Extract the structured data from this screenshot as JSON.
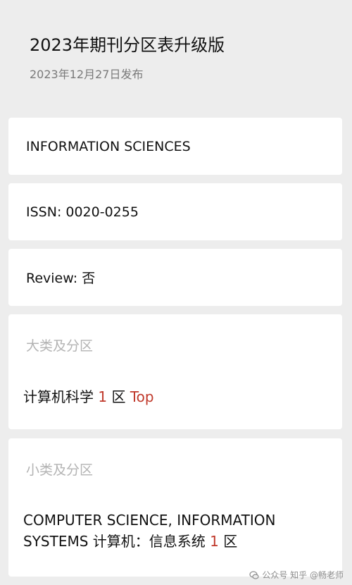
{
  "header": {
    "title": "2023年期刊分区表升级版",
    "date": "2023年12月27日发布"
  },
  "journal": {
    "name": "INFORMATION SCIENCES",
    "issn": "ISSN: 0020-0255",
    "review": "Review: 否"
  },
  "major": {
    "label": "大类及分区",
    "category": "计算机科学",
    "zone": "1",
    "zone_suffix": "区",
    "top": "Top"
  },
  "minor": {
    "label": "小类及分区",
    "category": "COMPUTER SCIENCE, INFORMATION SYSTEMS 计算机：信息系统",
    "zone": "1",
    "zone_suffix": "区"
  },
  "watermark": {
    "text": "公众号 知乎 @畅老师",
    "icon": "wechat-icon"
  },
  "colors": {
    "background": "#ededed",
    "card": "#ffffff",
    "accent_red": "#c0392b",
    "muted": "#b3b3b3"
  }
}
